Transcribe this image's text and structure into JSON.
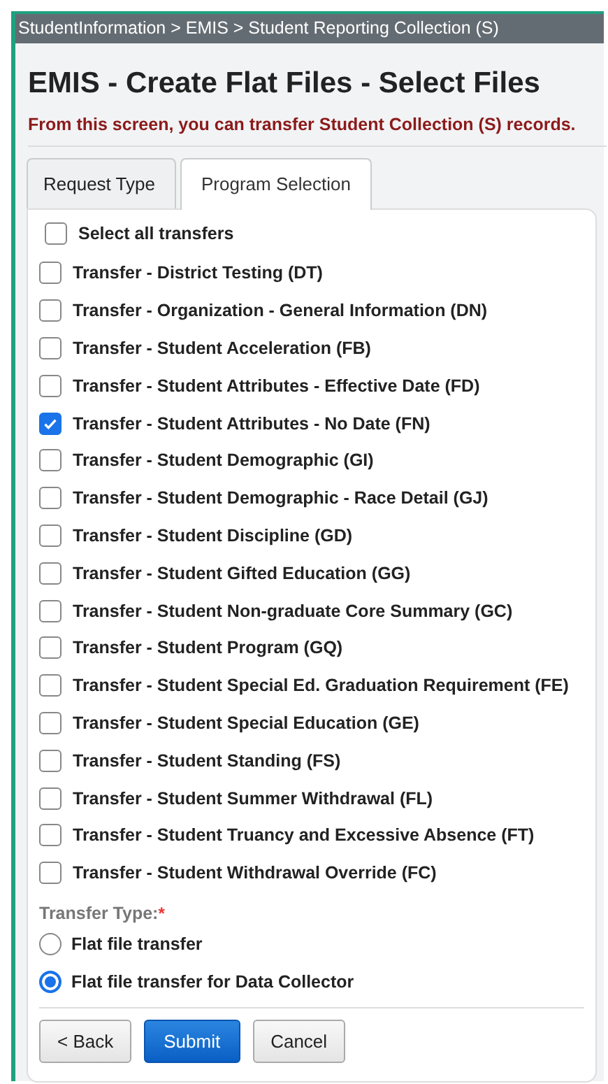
{
  "breadcrumb": "StudentInformation > EMIS > Student Reporting Collection (S)",
  "title": "EMIS - Create Flat Files - Select Files",
  "subtitle": "From this screen, you can transfer Student Collection (S) records.",
  "tabs": [
    {
      "label": "Request Type",
      "selected": false
    },
    {
      "label": "Program Selection",
      "selected": true
    }
  ],
  "select_all": {
    "label": "Select all transfers",
    "checked": false
  },
  "transfers": [
    {
      "label": "Transfer - District Testing (DT)",
      "checked": false
    },
    {
      "label": "Transfer - Organization - General Information (DN)",
      "checked": false
    },
    {
      "label": "Transfer - Student Acceleration (FB)",
      "checked": false
    },
    {
      "label": "Transfer - Student Attributes - Effective Date (FD)",
      "checked": false
    },
    {
      "label": "Transfer - Student Attributes - No Date (FN)",
      "checked": true
    },
    {
      "label": "Transfer - Student Demographic (GI)",
      "checked": false
    },
    {
      "label": "Transfer - Student Demographic - Race Detail (GJ)",
      "checked": false
    },
    {
      "label": "Transfer - Student Discipline (GD)",
      "checked": false
    },
    {
      "label": "Transfer - Student Gifted Education (GG)",
      "checked": false
    },
    {
      "label": "Transfer - Student Non-graduate Core Summary (GC)",
      "checked": false
    },
    {
      "label": "Transfer - Student Program (GQ)",
      "checked": false
    },
    {
      "label": "Transfer - Student Special Ed. Graduation Requirement (FE)",
      "checked": false
    },
    {
      "label": "Transfer - Student Special Education (GE)",
      "checked": false
    },
    {
      "label": "Transfer - Student Standing (FS)",
      "checked": false
    },
    {
      "label": "Transfer - Student Summer Withdrawal (FL)",
      "checked": false
    },
    {
      "label": "Transfer - Student Truancy and Excessive Absence (FT)",
      "checked": false
    },
    {
      "label": "Transfer - Student Withdrawal Override (FC)",
      "checked": false
    }
  ],
  "transfer_type": {
    "label": "Transfer Type:",
    "required_mark": "*",
    "options": [
      {
        "label": "Flat file transfer",
        "selected": false
      },
      {
        "label": "Flat file transfer for Data Collector",
        "selected": true
      }
    ]
  },
  "buttons": [
    {
      "label": "< Back",
      "kind": "default"
    },
    {
      "label": "Submit",
      "kind": "primary"
    },
    {
      "label": "Cancel",
      "kind": "default"
    }
  ]
}
